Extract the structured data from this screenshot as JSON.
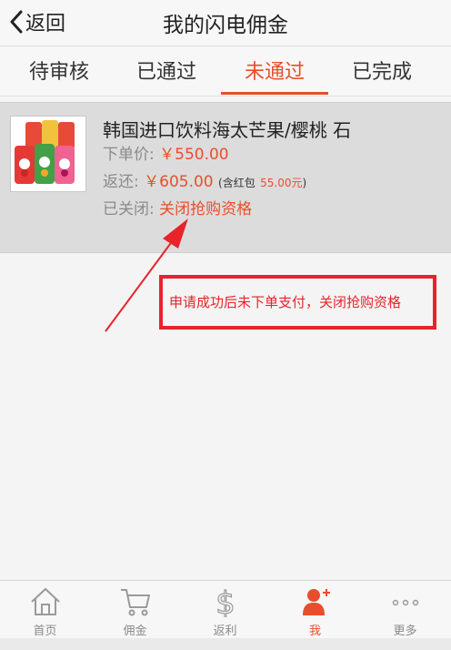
{
  "header": {
    "back_label": "返回",
    "title": "我的闪电佣金"
  },
  "tabs": [
    {
      "label": "待审核",
      "active": false
    },
    {
      "label": "已通过",
      "active": false
    },
    {
      "label": "未通过",
      "active": true
    },
    {
      "label": "已完成",
      "active": false
    }
  ],
  "order": {
    "product_name": "韩国进口饮料海太芒果/樱桃 石",
    "price_label": "下单价:",
    "price_value": "￥550.00",
    "rebate_label": "返还:",
    "rebate_value": "￥605.00",
    "redpacket_prefix": "(含红包",
    "redpacket_value": "55.00元",
    "redpacket_suffix": ")",
    "status_label": "已关闭:",
    "status_value": "关闭抢购资格"
  },
  "annotation": {
    "text": "申请成功后未下单支付，关闭抢购资格"
  },
  "tabbar": [
    {
      "label": "首页",
      "icon": "home-icon",
      "active": false
    },
    {
      "label": "佣金",
      "icon": "cart-icon",
      "active": false
    },
    {
      "label": "返利",
      "icon": "dollar-icon",
      "active": false
    },
    {
      "label": "我",
      "icon": "user-icon",
      "active": true
    },
    {
      "label": "更多",
      "icon": "more-icon",
      "active": false
    }
  ],
  "colors": {
    "accent": "#e94e2c",
    "annotation": "#e8232a"
  }
}
